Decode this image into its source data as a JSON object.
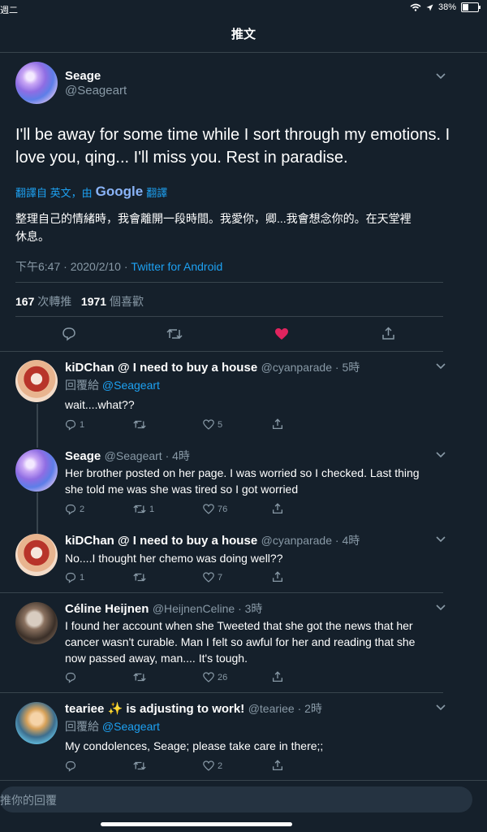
{
  "status": {
    "day": "週二",
    "battery": "38%"
  },
  "header": {
    "title": "推文"
  },
  "tweet": {
    "name": "Seage",
    "handle": "@Seageart",
    "text_line1": "I'll be away for some time while I sort through my emotions. I",
    "text_line2": "love you, qing... I'll miss you. Rest in paradise.",
    "translate_prefix": "翻譯自 英文，由",
    "translate_google": "Google",
    "translate_suffix": "翻譯",
    "translation_line1": "整理自己的情緒時，我會離開一段時間。我愛你，卿...我會想念你的。在天堂裡",
    "translation_line2": "休息。",
    "time": "下午6:47 · 2020/2/10 ·",
    "source": "Twitter for Android",
    "retweets_count": "167",
    "retweets_label": "次轉推",
    "likes_count": "1971",
    "likes_label": "個喜歡",
    "like_color": "#e0245e"
  },
  "replies": [
    {
      "name": "kiDChan @ I need to buy a house",
      "handle": "@cyanparade · 5時",
      "replying": "回覆給",
      "replying_to": "@Seageart",
      "text": "wait....what??",
      "comments": "1",
      "retweets": "",
      "likes": "5"
    },
    {
      "name": "Seage",
      "handle": "@Seageart · 4時",
      "text1": "Her brother posted on her page. I was worried so I checked. Last thing",
      "text2": "she told me was she was tired so I got worried",
      "comments": "2",
      "retweets": "1",
      "likes": "76"
    },
    {
      "name": "kiDChan @ I need to buy a house",
      "handle": "@cyanparade · 4時",
      "text": "No....I thought her chemo was doing well??",
      "comments": "1",
      "retweets": "",
      "likes": "7"
    },
    {
      "name": "Céline Heijnen",
      "handle": "@HeijnenCeline · 3時",
      "text1": "I found her account when she Tweeted that she got the news that her",
      "text2": "cancer wasn't curable. Man I felt so awful for her and reading that she",
      "text3": "now passed away, man.... It's tough.",
      "comments": "",
      "retweets": "",
      "likes": "26"
    },
    {
      "name": "teariee ✨ is adjusting to work!",
      "handle": "@teariee · 2時",
      "replying": "回覆給",
      "replying_to": "@Seageart",
      "text": "My condolences, Seage; please take care in there;;",
      "comments": "",
      "retweets": "",
      "likes": "2"
    }
  ],
  "compose": {
    "placeholder": "推你的回覆"
  }
}
